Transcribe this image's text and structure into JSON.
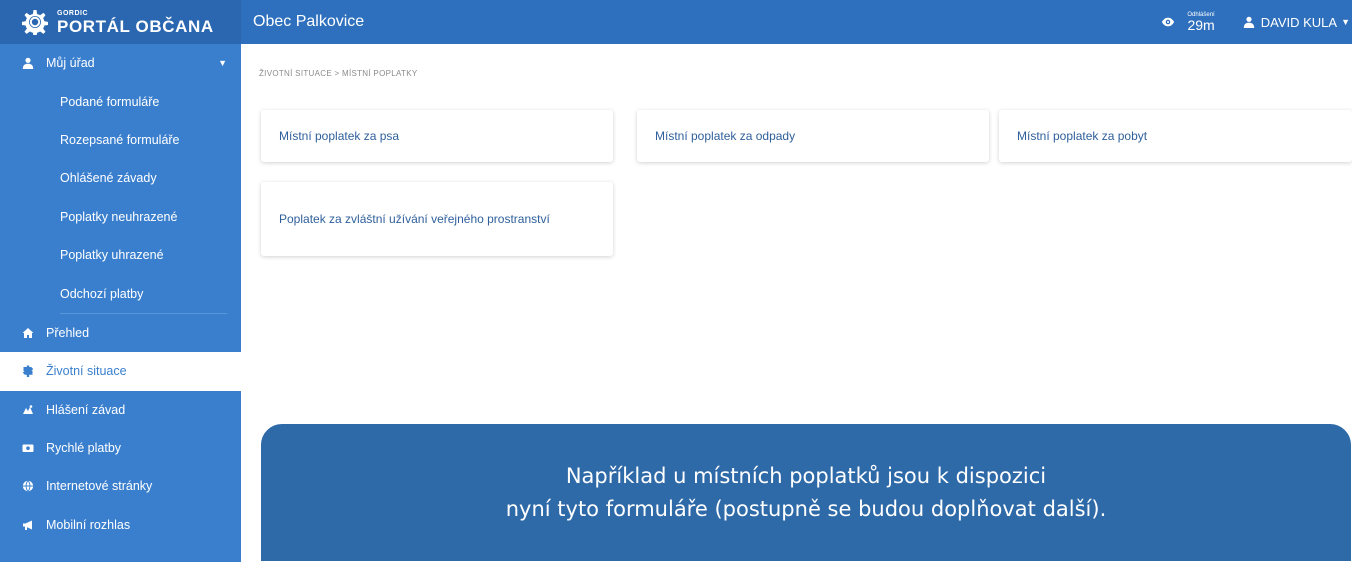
{
  "brand": {
    "small": "GORDIC",
    "big": "PORTÁL OBČANA"
  },
  "header": {
    "title": "Obec Palkovice",
    "timer_label": "Odhlášení",
    "timer_value": "29m",
    "user_name": "DAVID KULA"
  },
  "sidebar": {
    "my_office": "Můj úřad",
    "sub_items": [
      "Podané formuláře",
      "Rozepsané formuláře",
      "Ohlášené závady",
      "Poplatky neuhrazené",
      "Poplatky uhrazené",
      "Odchozí platby"
    ],
    "items": [
      "Přehled",
      "Životní situace",
      "Hlášení závad",
      "Rychlé platby",
      "Internetové stránky",
      "Mobilní rozhlas"
    ]
  },
  "breadcrumb": {
    "part1": "ŽIVOTNÍ SITUACE",
    "sep": ">",
    "part2": "MÍSTNÍ POPLATKY"
  },
  "cards": [
    "Místní poplatek za psa",
    "Místní poplatek za odpady",
    "Místní poplatek za pobyt",
    "Poplatek za zvláštní užívání veřejného prostranství"
  ],
  "overlay": {
    "line1": "Například u místních poplatků jsou k dispozici",
    "line2": "nyní tyto formuláře (postupně se budou doplňovat další)."
  },
  "colors": {
    "topbar": "#2e70bd",
    "sidebar": "#3a7fce",
    "overlay": "#2e69a8",
    "card_text": "#2f5f9a"
  },
  "icons": [
    "gordic-logo-icon",
    "eye-icon",
    "user-icon",
    "caret-down-icon",
    "home-icon",
    "signpost-icon",
    "defect-icon",
    "payment-icon",
    "globe-icon",
    "megaphone-icon"
  ]
}
